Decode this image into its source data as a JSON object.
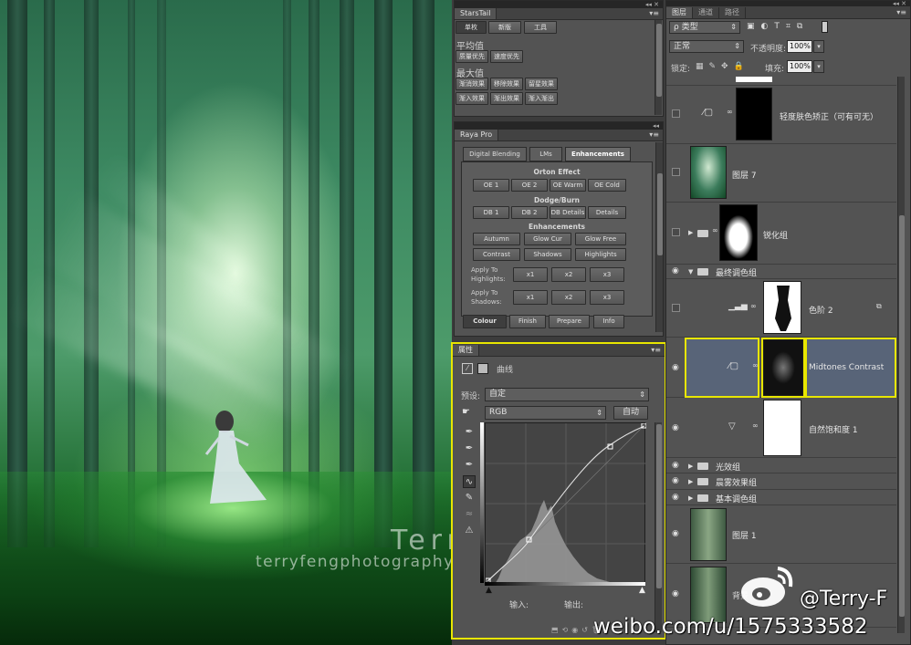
{
  "photo": {
    "watermark_name": "Terry-F",
    "watermark_site": "terryfengphotography.lofter.com"
  },
  "starstail": {
    "tab": "StarsTail",
    "buttons_top": [
      "单枚",
      "新版",
      "工具"
    ],
    "avg_label": "平均值",
    "avg_buttons": [
      "质量优先",
      "速度优先"
    ],
    "max_label": "最大值",
    "max_buttons": [
      "渐消效果",
      "移除效果",
      "留星效果",
      "渐入效果",
      "渐出效果",
      "渐入渐出"
    ]
  },
  "raya": {
    "tab": "Raya Pro",
    "tabs": [
      "Digital Blending",
      "LMs",
      "Enhancements"
    ],
    "orton_title": "Orton Effect",
    "orton": [
      "OE 1",
      "OE 2",
      "OE Warm",
      "OE Cold"
    ],
    "dodge_title": "Dodge/Burn",
    "dodge": [
      "DB 1",
      "DB 2",
      "DB Details",
      "Details"
    ],
    "enh_title": "Enhancements",
    "enh_row1": [
      "Autumn",
      "Glow Cur",
      "Glow Free"
    ],
    "enh_row2": [
      "Contrast",
      "Shadows",
      "Highlights"
    ],
    "apply_high": "Apply To Highlights:",
    "apply_shad": "Apply To Shadows:",
    "x_buttons": [
      "x1",
      "x2",
      "x3"
    ],
    "bottom": [
      "Colour",
      "Finish",
      "Prepare",
      "Info"
    ]
  },
  "properties": {
    "tab": "属性",
    "title": "曲线",
    "preset_label": "预设:",
    "preset_value": "自定",
    "channel": "RGB",
    "auto": "自动",
    "input_label": "输入:",
    "output_label": "输出:"
  },
  "layers": {
    "tabs": [
      "图层",
      "通道",
      "路径"
    ],
    "filter": "ρ 类型",
    "blend_mode": "正常",
    "opacity_label": "不透明度:",
    "opacity": "100%",
    "lock_label": "锁定:",
    "fill_label": "填充:",
    "fill": "100%",
    "rows": [
      {
        "name": "轻度肤色矫正（可有可无）"
      },
      {
        "name": "图层 7"
      },
      {
        "name": "锐化组"
      },
      {
        "name": "最终调色组"
      },
      {
        "name": "色阶 2"
      },
      {
        "name": "Midtones Contrast"
      },
      {
        "name": "自然饱和度 1"
      },
      {
        "name": "光效组"
      },
      {
        "name": "晨雾效果组"
      },
      {
        "name": "基本调色组"
      },
      {
        "name": "图层 1"
      },
      {
        "name": "背景"
      }
    ]
  },
  "overlay": {
    "weibo_handle": "@Terry-F",
    "weibo_url": "weibo.com/u/1575333582"
  },
  "colors": {
    "highlight": "#e8e600",
    "selected_layer": "#586478",
    "panel": "#535353"
  }
}
